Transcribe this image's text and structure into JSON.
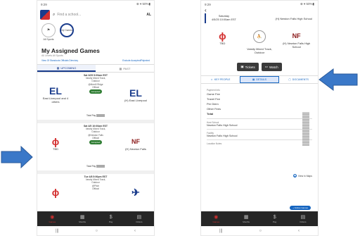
{
  "left": {
    "status_time": "9:29",
    "status_right": "⊕ ▾ 50%▮",
    "search_placeholder": "Find a school...",
    "state_code": "AL",
    "filters": [
      {
        "label": "All Sports",
        "icon": "▾"
      },
      {
        "label": "My Games",
        "icon": "My Games"
      }
    ],
    "title": "My Assigned Games",
    "subtitle": "All Levels  All Sports",
    "link_left": "View Of Standouts Officials Directory",
    "link_right": "Exclude Accepted/Rejected",
    "tab_upcoming": "UPCOMING",
    "tab_past": "PAST",
    "games": [
      {
        "date": "Sat 3/29 9:00am EST",
        "venue": "Varsity Mixed Track,",
        "level": "Outdoor",
        "site": "@Merrill Ridge",
        "role": "Official",
        "status": "Accepted",
        "home_name": "East Liverpool and 4 others",
        "home_mark": "EL",
        "away_name": "(H) East Liverpool",
        "away_mark": "EL",
        "pay_label": "Total Pay"
      },
      {
        "date": "Sat 4/5 10:00am EST",
        "venue": "Varsity Mixed Track,",
        "level": "Outdoor",
        "site": "@Newton Falls",
        "role": "Official",
        "status": "Accepted",
        "home_name": "TBD",
        "home_mark": "ɸ",
        "away_name": "(H) Newton Falls",
        "away_mark": "NF",
        "pay_label": "Total Pay"
      },
      {
        "date": "Tue 4/8 5:00pm EST",
        "venue": "Varsity Mixed Track,",
        "level": "Outdoor",
        "site": "@Pitch",
        "role": "Official",
        "status": "",
        "home_name": "",
        "home_mark": "ɸ",
        "away_name": "",
        "away_mark": "✈",
        "pay_label": ""
      }
    ]
  },
  "right": {
    "status_time": "9:29",
    "status_right": "⊕ ▾ 50%▮",
    "back": "‹",
    "date_day": "Saturday",
    "date_full": "4/5/25 10:00am EST",
    "header_school": "(H) Newton Falls High School",
    "home_name": "TBD",
    "venue_name": "Varsity Mixed Track, Outdoor",
    "away_name": "(H) Newton Falls High School",
    "btn_tickets": "Tickets",
    "btn_watch": "Watch",
    "tab_people": "KEY PEOPLE",
    "tab_details": "DETAILS",
    "tab_documents": "DOCUMENTS",
    "payment_label": "Payment Info",
    "fees": [
      "Game Fee",
      "Travel Fee",
      "Per Diem",
      "Other Fees",
      "Total"
    ],
    "host_label": "Host School",
    "host_value": "Newton Falls High School",
    "facility_label": "Facility",
    "facility_value": "Newton Falls High School",
    "maps_label": "View in Maps",
    "location_notes": "Location Notes",
    "fab_label": "+ Follow Games"
  },
  "tabs": [
    "Games",
    "Months",
    "Pay",
    "Orders"
  ],
  "sysnav": [
    "|||",
    "○",
    "‹"
  ],
  "accent": "#1a3c8c",
  "arrow_color": "#3a78c8"
}
